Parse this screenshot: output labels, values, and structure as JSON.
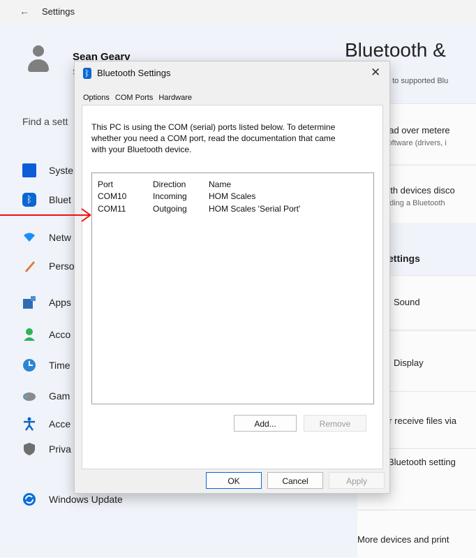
{
  "window": {
    "title": "Settings",
    "back_icon": "back-arrow-icon"
  },
  "user": {
    "name": "Sean Gearv",
    "sub": "S"
  },
  "search": {
    "label": "Find a sett"
  },
  "nav": [
    {
      "label": "Syste",
      "icon": "system-icon",
      "color": "#0b5ed7"
    },
    {
      "label": "Bluet",
      "icon": "bluetooth-icon",
      "color": "#0a66d1"
    },
    {
      "label": "Netw",
      "icon": "network-icon",
      "color": "#1b8ff6"
    },
    {
      "label": "Perso",
      "icon": "personalization-icon",
      "color": "#d97b3f"
    },
    {
      "label": "Apps",
      "icon": "apps-icon",
      "color": "#2f6db2"
    },
    {
      "label": "Acco",
      "icon": "accounts-icon",
      "color": "#2fb05a"
    },
    {
      "label": "Time",
      "icon": "time-icon",
      "color": "#2b86d6"
    },
    {
      "label": "Gam",
      "icon": "gaming-icon",
      "color": "#7a7a7a"
    },
    {
      "label": "Acce",
      "icon": "accessibility-icon",
      "color": "#0b63c9"
    },
    {
      "label": "Priva",
      "icon": "privacy-icon",
      "color": "#6f6f6f"
    },
    {
      "label": "Windows Update",
      "icon": "windows-update-icon",
      "color": "#0b6fd8"
    }
  ],
  "page": {
    "title": "Bluetooth &",
    "subtitle": "t to supported Blu"
  },
  "cards": [
    {
      "title": "oad over metere",
      "sub": "software (drivers, i"
    },
    {
      "title": "oth devices disco",
      "sub": "dding a Bluetooth"
    }
  ],
  "related": {
    "heading": "ettings",
    "items": [
      "Sound",
      "Display",
      "or receive files via",
      "Bluetooth setting",
      "More devices and print"
    ]
  },
  "dialog": {
    "title": "Bluetooth Settings",
    "close": "✕",
    "tabs": [
      "Options",
      "COM Ports",
      "Hardware"
    ],
    "description": "This PC is using the COM (serial) ports listed below. To determine whether you need a COM port, read the documentation that came with your Bluetooth device.",
    "columns": {
      "port": "Port",
      "direction": "Direction",
      "name": "Name"
    },
    "rows": [
      {
        "port": "COM10",
        "direction": "Incoming",
        "name": "HOM Scales"
      },
      {
        "port": "COM11",
        "direction": "Outgoing",
        "name": "HOM Scales 'Serial Port'"
      }
    ],
    "buttons": {
      "add": "Add...",
      "remove": "Remove",
      "ok": "OK",
      "cancel": "Cancel",
      "apply": "Apply"
    }
  },
  "colors": {
    "accent": "#0a66d1",
    "annotation": "#e11111"
  }
}
